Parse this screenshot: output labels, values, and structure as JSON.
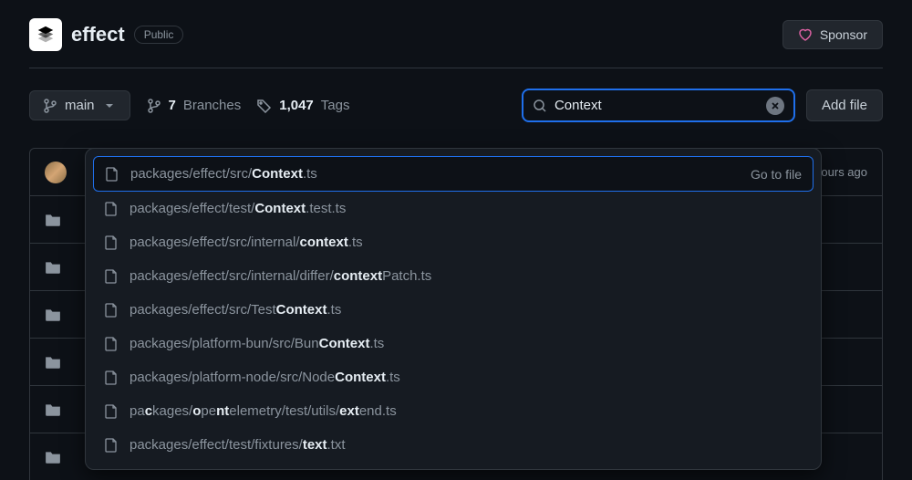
{
  "header": {
    "repo_name": "effect",
    "visibility": "Public",
    "sponsor_label": "Sponsor"
  },
  "subnav": {
    "branch_name": "main",
    "branches_count": "7",
    "branches_label": "Branches",
    "tags_count": "1,047",
    "tags_label": "Tags",
    "add_file_label": "Add file"
  },
  "search": {
    "value": "Context",
    "placeholder": "Go to file"
  },
  "commit_row": {
    "time_ago": "hours ago"
  },
  "dropdown": {
    "go_to_file": "Go to file",
    "results": [
      {
        "segments": [
          "packages/effect/src/",
          "Context",
          ".ts"
        ]
      },
      {
        "segments": [
          "packages/effect/test/",
          "Context",
          ".test.ts"
        ]
      },
      {
        "segments": [
          "packages/effect/src/internal/",
          "context",
          ".ts"
        ]
      },
      {
        "segments": [
          "packages/effect/src/internal/differ/",
          "context",
          "Patch.ts"
        ]
      },
      {
        "segments": [
          "packages/effect/src/Test",
          "Context",
          ".ts"
        ]
      },
      {
        "segments": [
          "packages/platform-bun/src/Bun",
          "Context",
          ".ts"
        ]
      },
      {
        "segments": [
          "packages/platform-node/src/Node",
          "Context",
          ".ts"
        ]
      },
      {
        "segments": [
          "pa",
          "c",
          "kages/",
          "o",
          "pe",
          "nt",
          "elemetry/test/utils/",
          "ext",
          "end.ts"
        ]
      },
      {
        "segments": [
          "packages/effect/test/fixtures/",
          "text",
          ".txt"
        ]
      }
    ]
  }
}
